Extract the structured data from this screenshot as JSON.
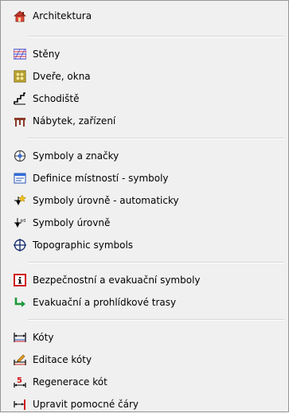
{
  "menu": {
    "items": [
      {
        "label": "Architektura",
        "icon": "house-icon"
      },
      {
        "label": "Stěny",
        "icon": "wall-hatch-icon"
      },
      {
        "label": "Dveře, okna",
        "icon": "door-window-icon"
      },
      {
        "label": "Schodiště",
        "icon": "stairs-icon"
      },
      {
        "label": "Nábytek, zařízení",
        "icon": "furniture-table-icon"
      },
      {
        "label": "Symboly a značky",
        "icon": "symbol-circle-icon"
      },
      {
        "label": "Definice místností - symboly",
        "icon": "room-definition-icon"
      },
      {
        "label": "Symboly úrovně - automaticky",
        "icon": "level-auto-icon"
      },
      {
        "label": "Symboly úrovně",
        "icon": "level-symbol-icon"
      },
      {
        "label": "Topographic symbols",
        "icon": "topographic-crosshair-icon"
      },
      {
        "label": "Bezpečnostní a evakuační symboly",
        "icon": "safety-info-icon"
      },
      {
        "label": "Evakuační a prohlídkové trasy",
        "icon": "evacuation-arrow-icon"
      },
      {
        "label": "Kóty",
        "icon": "dimension-icon"
      },
      {
        "label": "Editace kóty",
        "icon": "edit-dimension-icon"
      },
      {
        "label": "Regenerace kót",
        "icon": "regenerate-dimension-icon"
      },
      {
        "label": "Upravit pomocné čáry",
        "icon": "helper-lines-icon"
      }
    ]
  }
}
